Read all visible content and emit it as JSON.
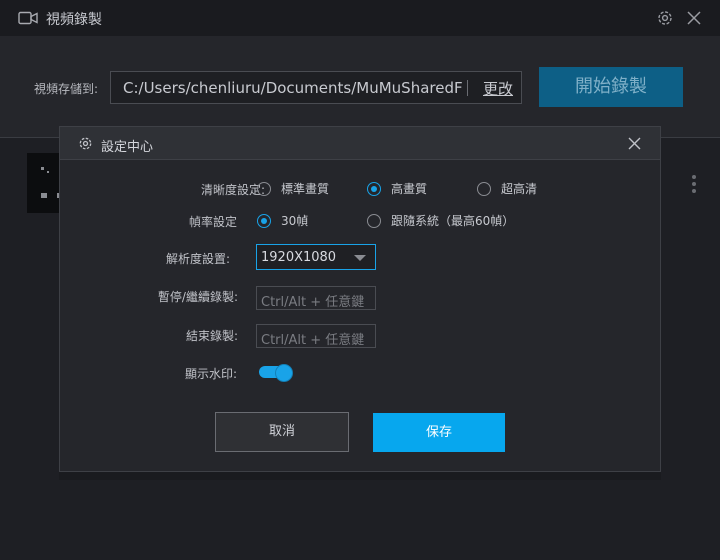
{
  "app": {
    "title": "視頻錄製"
  },
  "savebar": {
    "label": "視頻存儲到:",
    "path": "C:/Users/chenliuru/Documents/MuMuSharedFolder",
    "change": "更改",
    "start": "開始錄製"
  },
  "modal": {
    "title": "設定中心",
    "quality": {
      "label": "清晰度設定:",
      "options": [
        "標準畫質",
        "高畫質",
        "超高清"
      ],
      "selected": "高畫質"
    },
    "framerate": {
      "label": "幀率設定",
      "options": [
        "30幀",
        "跟隨系統（最高60幀）"
      ],
      "selected": "30幀"
    },
    "resolution": {
      "label": "解析度設置:",
      "value": "1920X1080"
    },
    "pause_hotkey": {
      "label": "暫停/繼續錄製:",
      "placeholder": "Ctrl/Alt + 任意鍵"
    },
    "stop_hotkey": {
      "label": "結束錄製:",
      "placeholder": "Ctrl/Alt + 任意鍵"
    },
    "watermark": {
      "label": "顯示水印:",
      "enabled": true
    },
    "cancel": "取消",
    "save": "保存"
  },
  "colors": {
    "accent": "#19a3e8",
    "save_button": "#07a7ee",
    "start_button": "#0d5f86"
  },
  "icons": [
    "video-camera-icon",
    "gear-icon",
    "close-icon",
    "more-vertical-icon"
  ]
}
